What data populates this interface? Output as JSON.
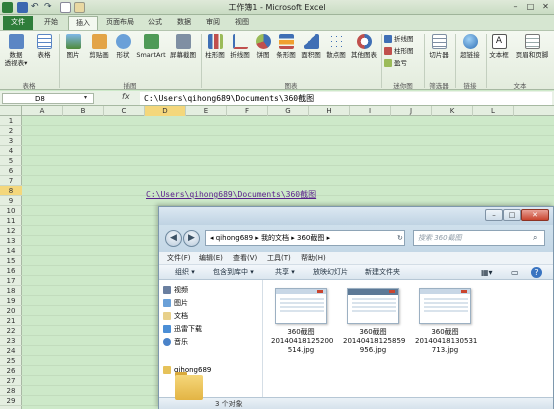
{
  "window": {
    "title": "工作簿1 - Microsoft Excel"
  },
  "ribbon_tabs": [
    "文件",
    "开始",
    "插入",
    "页面布局",
    "公式",
    "数据",
    "审阅",
    "视图"
  ],
  "ribbon": {
    "groups": [
      "表格",
      "插图",
      "图表",
      "迷你图",
      "筛选器",
      "链接",
      "文本"
    ],
    "table_buttons": [
      {
        "label1": "数据",
        "label2": "透视表▾"
      },
      {
        "label1": "表格",
        "label2": ""
      }
    ],
    "illus_buttons": [
      "图片",
      "剪贴画",
      "形状",
      "SmartArt",
      "屏幕截图"
    ],
    "chart_buttons": [
      "柱形图",
      "折线图",
      "饼图",
      "条形图",
      "面积图",
      "散点图",
      "其他图表"
    ],
    "sparklines": [
      "折线图",
      "柱形图",
      "盈亏"
    ],
    "filter_button": "切片器",
    "link_button": "超链接",
    "text_buttons": [
      "文本框",
      "页眉和页脚"
    ]
  },
  "formula_bar": {
    "name_box": "D8",
    "fx": "fx",
    "content": "C:\\Users\\qihong689\\Documents\\360截图"
  },
  "columns": [
    "A",
    "B",
    "C",
    "D",
    "E",
    "F",
    "G",
    "H",
    "I",
    "J",
    "K",
    "L"
  ],
  "rows": [
    "1",
    "2",
    "3",
    "4",
    "5",
    "6",
    "7",
    "8",
    "9",
    "10",
    "11",
    "12",
    "13",
    "14",
    "15",
    "16",
    "17",
    "18",
    "19",
    "20",
    "21",
    "22",
    "23",
    "24",
    "25",
    "26",
    "27",
    "28",
    "29"
  ],
  "cell_d8": "C:\\Users\\qihong689\\Documents\\360截图",
  "explorer": {
    "address": "◂ qihong689 ▸ 我的文档 ▸ 360截图 ▸",
    "search_placeholder": "搜索 360截图",
    "menu": [
      "文件(F)",
      "编辑(E)",
      "查看(V)",
      "工具(T)",
      "帮助(H)"
    ],
    "toolbar": [
      "组织 ▾",
      "包含到库中 ▾",
      "共享 ▾",
      "放映幻灯片",
      "新建文件夹"
    ],
    "nav": [
      "视频",
      "图片",
      "文档",
      "迅雷下载",
      "音乐",
      "qihong689"
    ],
    "files": [
      {
        "line1": "360截图",
        "line2": "20140418125200",
        "line3": "514.jpg"
      },
      {
        "line1": "360截图",
        "line2": "20140418125859",
        "line3": "956.jpg"
      },
      {
        "line1": "360截图",
        "line2": "20140418130531",
        "line3": "713.jpg"
      }
    ],
    "status": "3 个对象"
  },
  "colors": {
    "excel_green": "#2e7d3a",
    "sheet_bg": "#cde9c9",
    "hyperlink": "#5a1f8c"
  }
}
